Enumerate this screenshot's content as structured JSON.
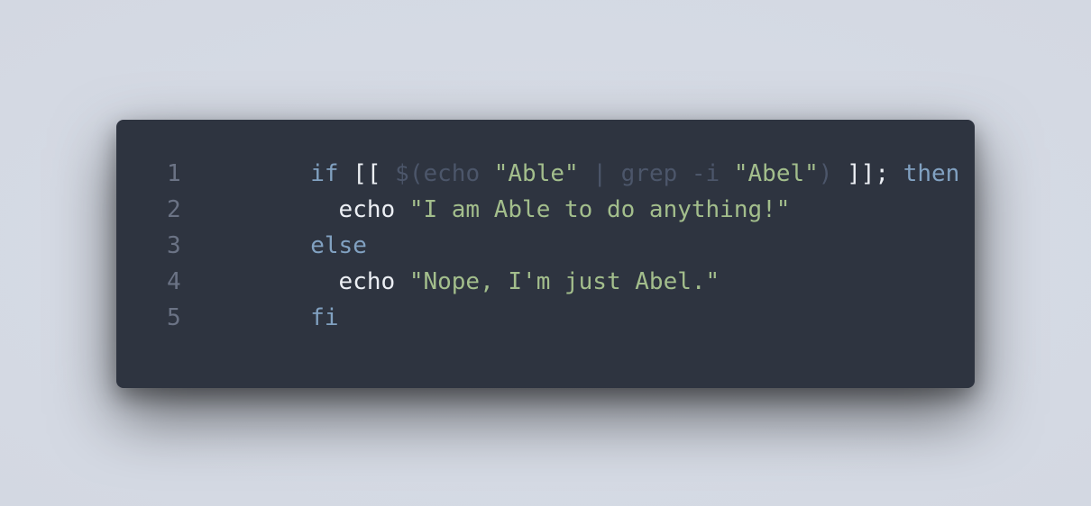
{
  "code": {
    "lines": [
      {
        "number": "1",
        "tokens": [
          {
            "text": "if",
            "kind": "keyword"
          },
          {
            "text": " [[ ",
            "kind": "plain"
          },
          {
            "text": "$(echo ",
            "kind": "dim"
          },
          {
            "text": "\"Able\"",
            "kind": "string"
          },
          {
            "text": " | grep -i ",
            "kind": "dim"
          },
          {
            "text": "\"Abel\"",
            "kind": "string"
          },
          {
            "text": ")",
            "kind": "dim"
          },
          {
            "text": " ]]; ",
            "kind": "plain"
          },
          {
            "text": "then",
            "kind": "keyword"
          }
        ]
      },
      {
        "number": "2",
        "tokens": [
          {
            "text": "  echo ",
            "kind": "plain"
          },
          {
            "text": "\"I am Able to do anything!\"",
            "kind": "string"
          }
        ]
      },
      {
        "number": "3",
        "tokens": [
          {
            "text": "else",
            "kind": "keyword"
          }
        ]
      },
      {
        "number": "4",
        "tokens": [
          {
            "text": "  echo ",
            "kind": "plain"
          },
          {
            "text": "\"Nope, I'm just Abel.\"",
            "kind": "string"
          }
        ]
      },
      {
        "number": "5",
        "tokens": [
          {
            "text": "fi",
            "kind": "keyword"
          }
        ]
      }
    ]
  },
  "colors": {
    "background": "#d7dce6",
    "editor_background": "#2e3440",
    "line_number": "#6b7385",
    "keyword": "#81a1c1",
    "plain": "#eceff4",
    "string": "#a3be8c",
    "dim": "#4c566a"
  }
}
